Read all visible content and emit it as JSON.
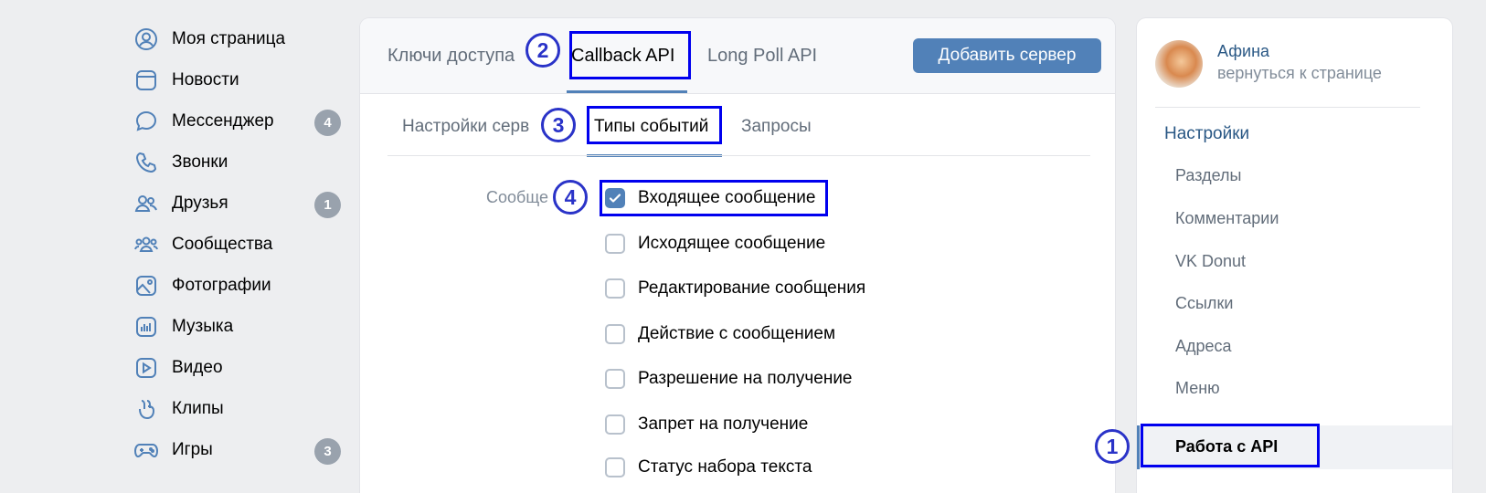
{
  "left_nav": {
    "items": [
      {
        "label": "Моя страница",
        "icon": "user-circle-icon",
        "badge": ""
      },
      {
        "label": "Новости",
        "icon": "news-icon",
        "badge": ""
      },
      {
        "label": "Мессенджер",
        "icon": "chat-bubble-icon",
        "badge": "4"
      },
      {
        "label": "Звонки",
        "icon": "phone-icon",
        "badge": ""
      },
      {
        "label": "Друзья",
        "icon": "friends-icon",
        "badge": "1"
      },
      {
        "label": "Сообщества",
        "icon": "communities-icon",
        "badge": ""
      },
      {
        "label": "Фотографии",
        "icon": "photo-icon",
        "badge": ""
      },
      {
        "label": "Музыка",
        "icon": "music-icon",
        "badge": ""
      },
      {
        "label": "Видео",
        "icon": "video-icon",
        "badge": ""
      },
      {
        "label": "Клипы",
        "icon": "clips-icon",
        "badge": ""
      },
      {
        "label": "Игры",
        "icon": "gamepad-icon",
        "badge": "3"
      }
    ]
  },
  "main": {
    "tabs": [
      "Ключи доступа",
      "Callback API",
      "Long Poll API"
    ],
    "add_server_button": "Добавить сервер",
    "subtabs": [
      "Настройки серв",
      "Типы событий",
      "Запросы"
    ],
    "section_label": "Сообще",
    "checkboxes": [
      {
        "label": "Входящее сообщение",
        "checked": true
      },
      {
        "label": "Исходящее сообщение",
        "checked": false
      },
      {
        "label": "Редактирование сообщения",
        "checked": false
      },
      {
        "label": "Действие с сообщением",
        "checked": false
      },
      {
        "label": "Разрешение на получение",
        "checked": false
      },
      {
        "label": "Запрет на получение",
        "checked": false
      },
      {
        "label": "Статус набора текста",
        "checked": false
      }
    ]
  },
  "right_panel": {
    "name": "Афина",
    "back_link": "вернуться к странице",
    "settings_title": "Настройки",
    "items": [
      "Разделы",
      "Комментарии",
      "VK Donut",
      "Ссылки",
      "Адреса",
      "Меню",
      "Работа с API"
    ],
    "active_item": "Работа с API"
  },
  "annotations": {
    "step1": "1",
    "step2": "2",
    "step3": "3",
    "step4": "4",
    "color": "#0000ee"
  },
  "colors": {
    "accent": "#5181b8",
    "link": "#2a5885",
    "muted": "#818c99",
    "badge": "#99a2ad"
  }
}
